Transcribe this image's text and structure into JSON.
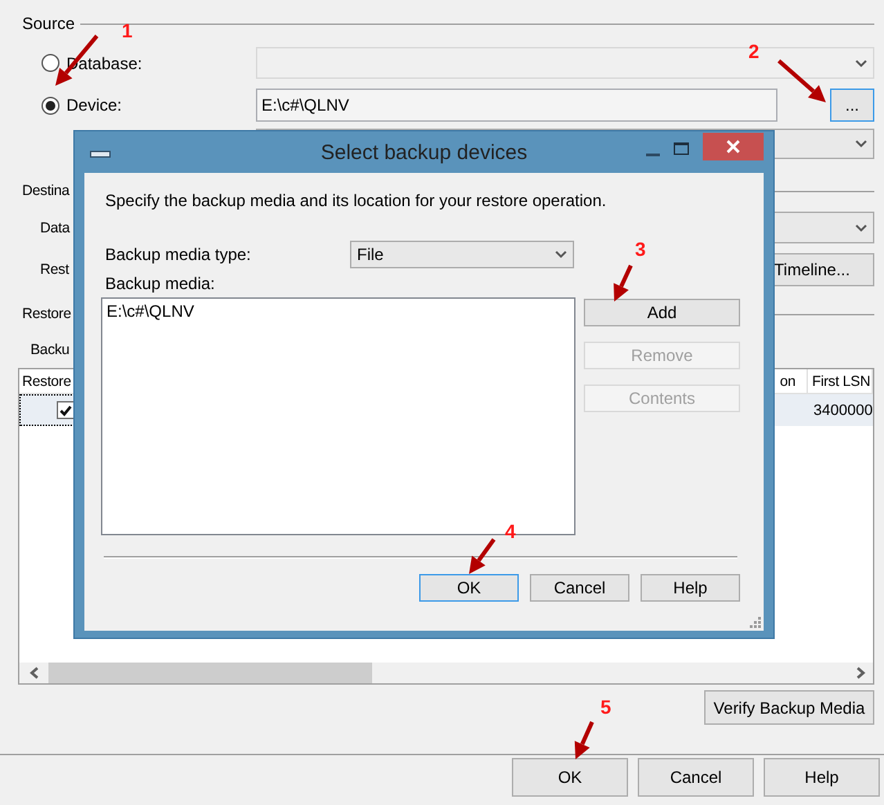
{
  "source": {
    "title": "Source",
    "options": [
      {
        "label": "Database:",
        "selected": false
      },
      {
        "label": "Device:",
        "selected": true
      }
    ],
    "device_path": "E:\\c#\\QLNV",
    "browse_button": {
      "label": "...",
      "focused": true
    }
  },
  "destination": {
    "title": "Destina",
    "labels": [
      "Data",
      "Rest"
    ],
    "timeline_button": "Timeline..."
  },
  "restore_plan": {
    "title": "Restore",
    "label": "Backu",
    "table": {
      "columns": [
        "Restore",
        "on",
        "First LSN"
      ],
      "rows": [
        {
          "restore_checked": true,
          "first_lsn": "3400000"
        }
      ]
    }
  },
  "verify_button": "Verify Backup Media",
  "buttons": [
    {
      "label": "OK",
      "focused": false
    },
    {
      "label": "Cancel",
      "focused": false
    },
    {
      "label": "Help",
      "focused": false
    }
  ],
  "dialog": {
    "title": "Select backup devices",
    "description": "Specify the backup media and its location for your restore operation.",
    "media_type_label": "Backup media type:",
    "media_type": "File",
    "media_label": "Backup media:",
    "media": [
      "E:\\c#\\QLNV"
    ],
    "side_buttons": [
      {
        "label": "Add",
        "disabled": false
      },
      {
        "label": "Remove",
        "disabled": true
      },
      {
        "label": "Contents",
        "disabled": true
      }
    ],
    "buttons": [
      {
        "label": "OK",
        "focused": true
      },
      {
        "label": "Cancel",
        "focused": false
      },
      {
        "label": "Help",
        "focused": false
      }
    ]
  },
  "annotations": [
    {
      "label": "1"
    },
    {
      "label": "2"
    },
    {
      "label": "3"
    },
    {
      "label": "4"
    },
    {
      "label": "5"
    }
  ]
}
